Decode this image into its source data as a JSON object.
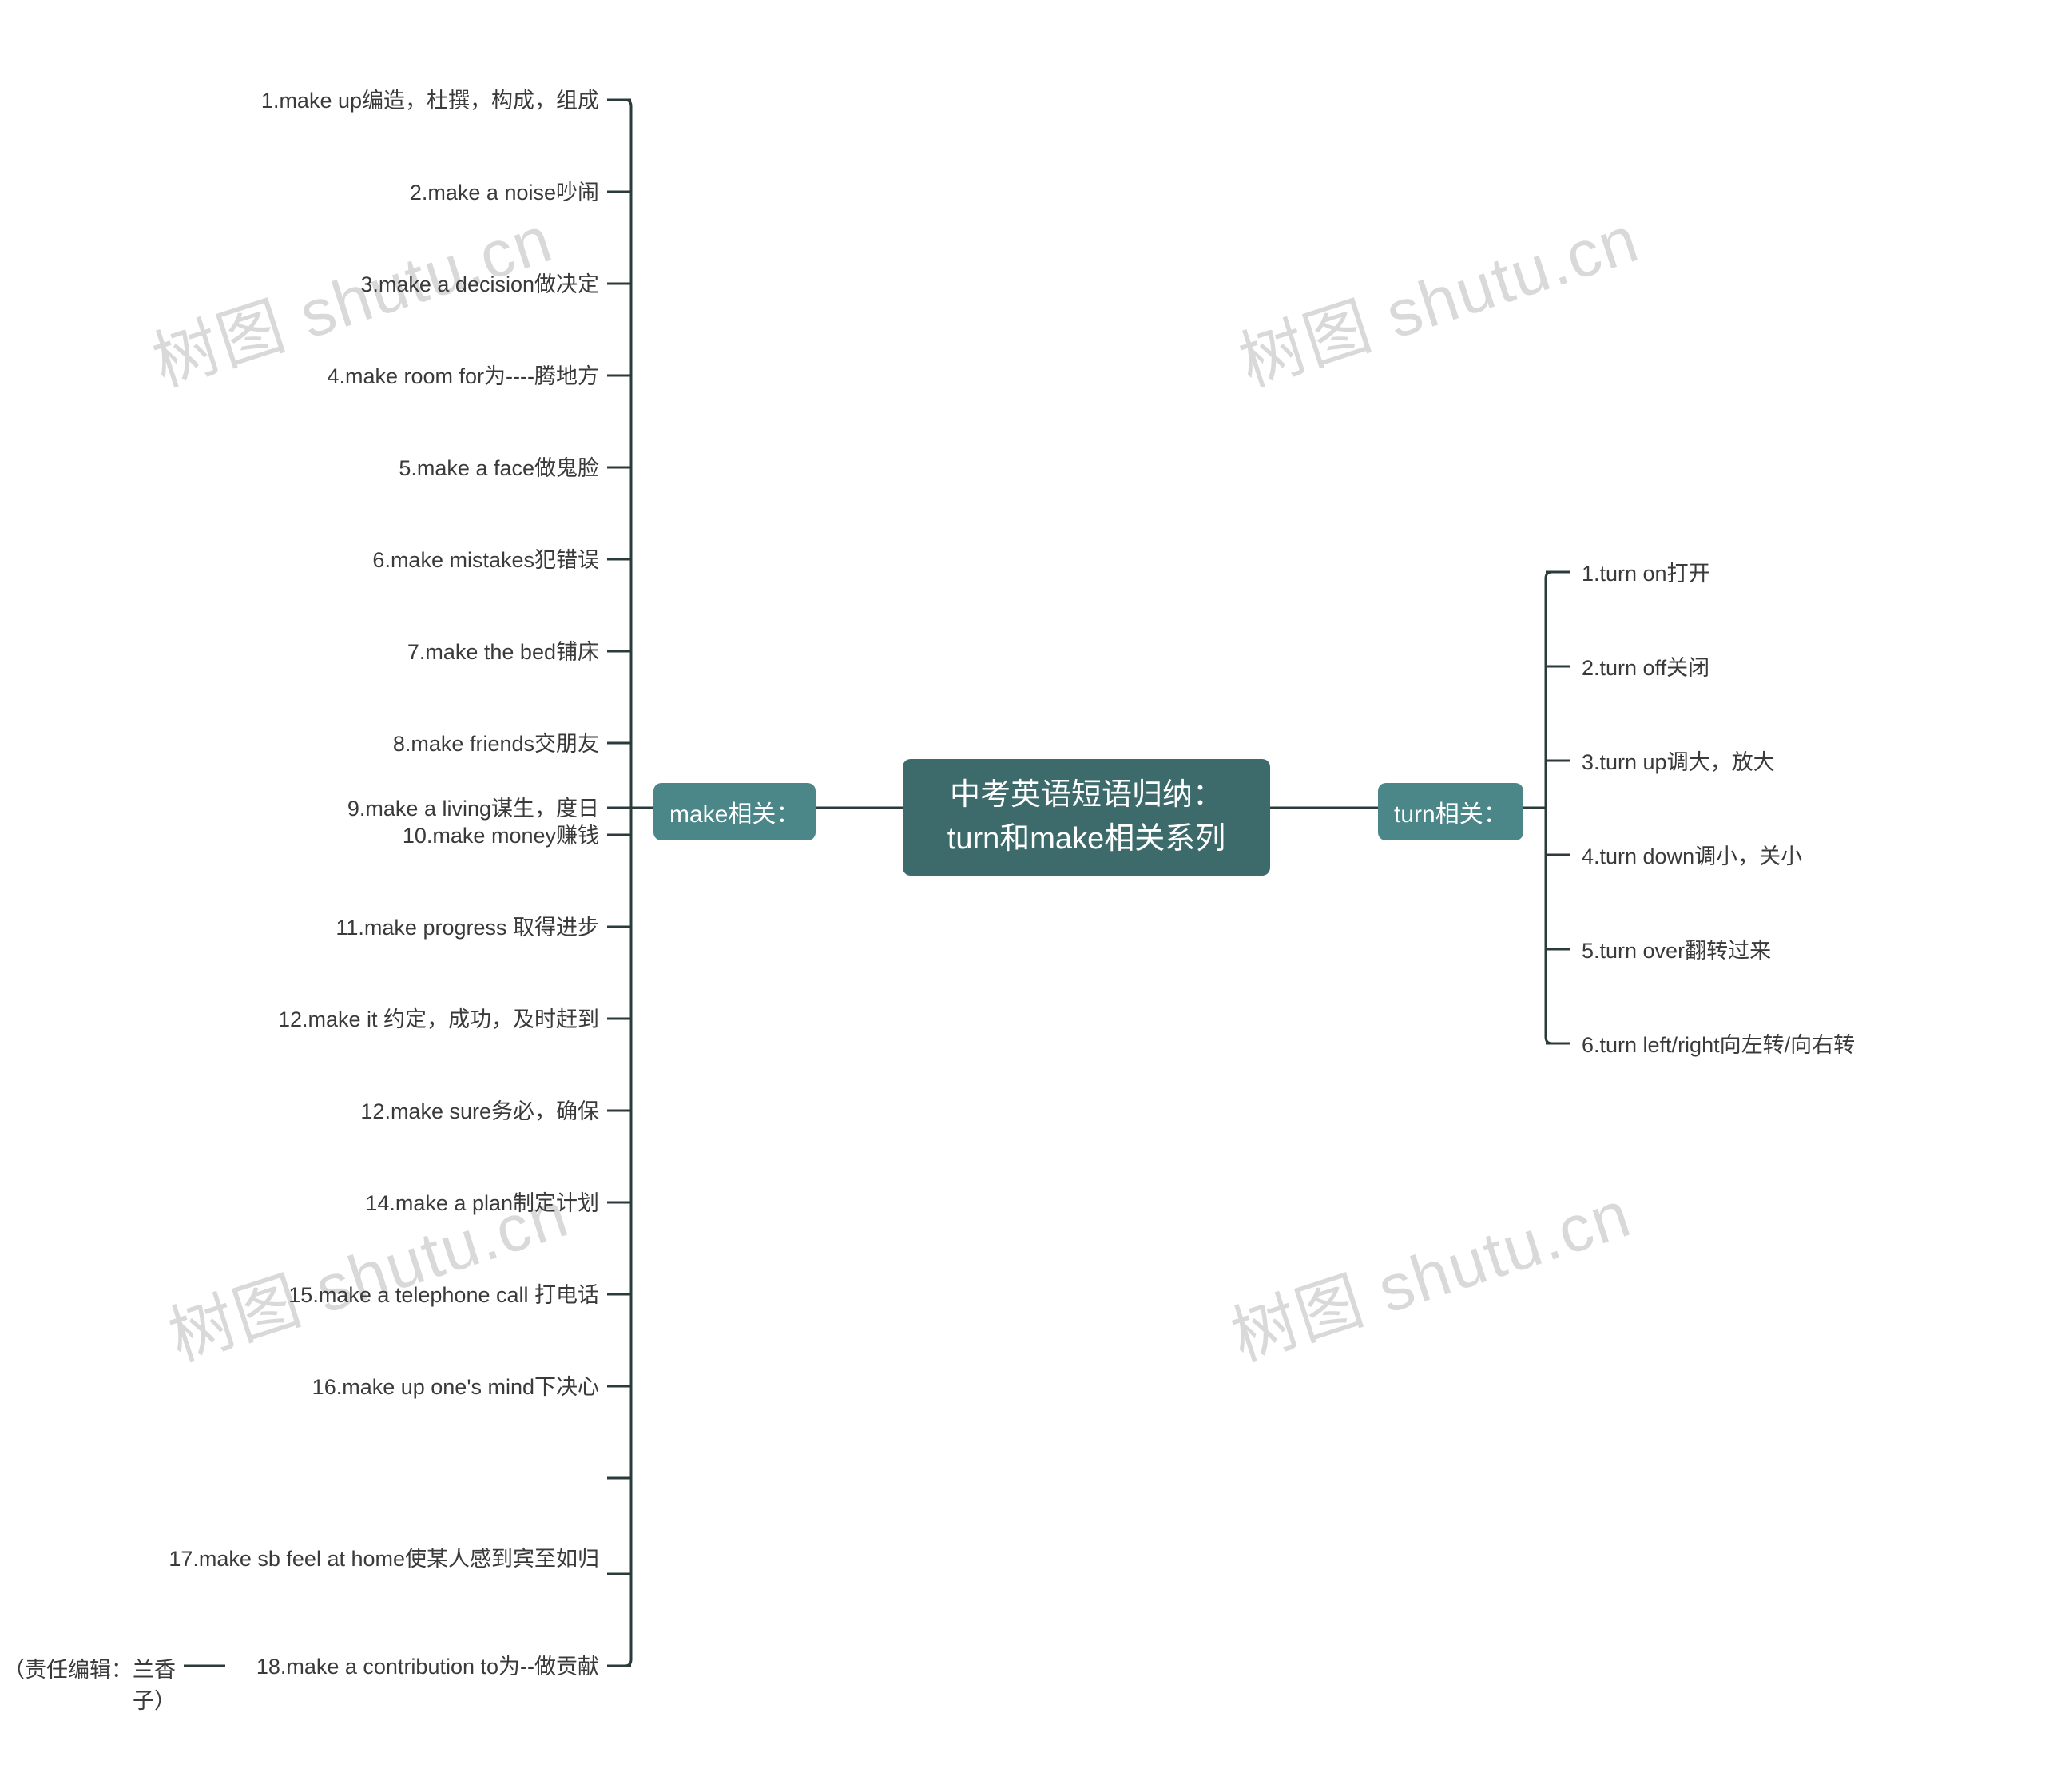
{
  "chart_data": {
    "type": "mindmap",
    "root": "中考英语短语归纳：turn和make相关系列",
    "branches": [
      {
        "name": "make相关：",
        "side": "left",
        "children": [
          {
            "text": "1.make up编造，杜撰，构成，组成"
          },
          {
            "text": "2.make a noise吵闹"
          },
          {
            "text": "3.make a decision做决定"
          },
          {
            "text": "4.make room for为----腾地方"
          },
          {
            "text": "5.make a face做鬼脸"
          },
          {
            "text": "6.make mistakes犯错误"
          },
          {
            "text": "7.make the bed铺床"
          },
          {
            "text": "8.make friends交朋友"
          },
          {
            "text": "9.make a living谋生，度日"
          },
          {
            "text": "10.make money赚钱"
          },
          {
            "text": "11.make progress 取得进步"
          },
          {
            "text": "12.make it 约定，成功，及时赶到"
          },
          {
            "text": "12.make sure务必，确保"
          },
          {
            "text": "14.make a plan制定计划"
          },
          {
            "text": "15.make a telephone call 打电话"
          },
          {
            "text": "16.make up one's mind下决心"
          },
          {
            "text": "17.make sb feel at home使某人感到宾至如归"
          },
          {
            "text": "18.make a contribution to为--做贡献",
            "children": [
              "（责任编辑：兰香子）"
            ]
          }
        ]
      },
      {
        "name": "turn相关：",
        "side": "right",
        "children": [
          {
            "text": "1.turn on打开"
          },
          {
            "text": "2.turn off关闭"
          },
          {
            "text": "3.turn up调大，放大"
          },
          {
            "text": "4.turn down调小，关小"
          },
          {
            "text": "5.turn over翻转过来"
          },
          {
            "text": "6.turn left/right向左转/向右转"
          }
        ]
      }
    ]
  },
  "watermarks": [
    "树图 shutu.cn",
    "树图 shutu.cn",
    "树图 shutu.cn",
    "树图 shutu.cn"
  ],
  "root_label": "中考英语短语归纳：turn和make相关系列",
  "make_label": "make相关：",
  "turn_label": "turn相关：",
  "make_items": [
    "1.make up编造，杜撰，构成，组成",
    "2.make a noise吵闹",
    "3.make a decision做决定",
    "4.make room for为----腾地方",
    "5.make a face做鬼脸",
    "6.make mistakes犯错误",
    "7.make the bed铺床",
    "8.make friends交朋友",
    "9.make a living谋生，度日",
    "10.make money赚钱",
    "11.make progress 取得进步",
    "12.make it 约定，成功，及时赶到",
    "12.make sure务必，确保",
    "14.make a plan制定计划",
    "15.make a telephone call 打电话",
    "16.make up one's mind下决心",
    "17.make sb feel at home使某人感到宾至如归",
    "18.make a contribution to为--做贡献"
  ],
  "make_grandchild": "（责任编辑：兰香子）",
  "turn_items": [
    "1.turn on打开",
    "2.turn off关闭",
    "3.turn up调大，放大",
    "4.turn down调小，关小",
    "5.turn over翻转过来",
    "6.turn left/right向左转/向右转"
  ]
}
